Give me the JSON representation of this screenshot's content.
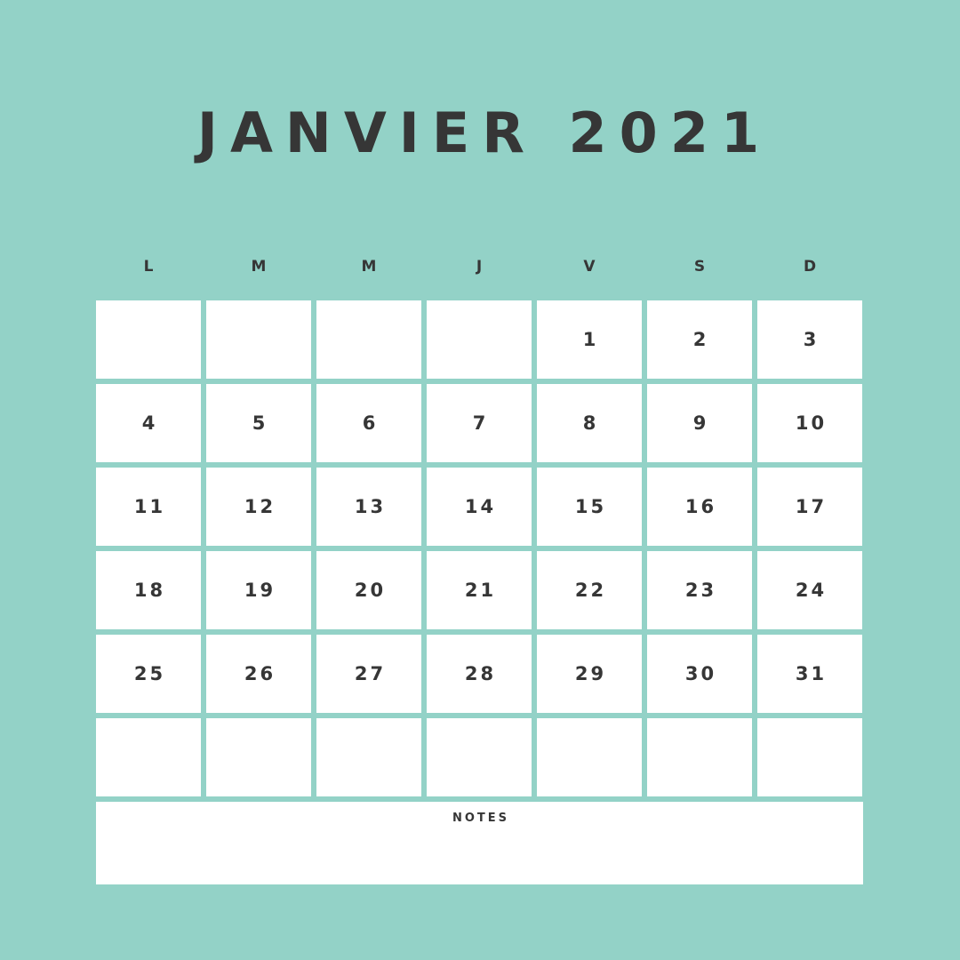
{
  "calendar": {
    "title": "JANVIER 2021",
    "weekdays": [
      "L",
      "M",
      "M",
      "J",
      "V",
      "S",
      "D"
    ],
    "weeks": [
      [
        "",
        "",
        "",
        "",
        "1",
        "2",
        "3"
      ],
      [
        "4",
        "5",
        "6",
        "7",
        "8",
        "9",
        "10"
      ],
      [
        "11",
        "12",
        "13",
        "14",
        "15",
        "16",
        "17"
      ],
      [
        "18",
        "19",
        "20",
        "21",
        "22",
        "23",
        "24"
      ],
      [
        "25",
        "26",
        "27",
        "28",
        "29",
        "30",
        "31"
      ],
      [
        "",
        "",
        "",
        "",
        "",
        "",
        ""
      ]
    ],
    "notes_label": "NOTES"
  },
  "colors": {
    "background": "#93d2c7",
    "cell": "#ffffff",
    "text": "#363636"
  }
}
